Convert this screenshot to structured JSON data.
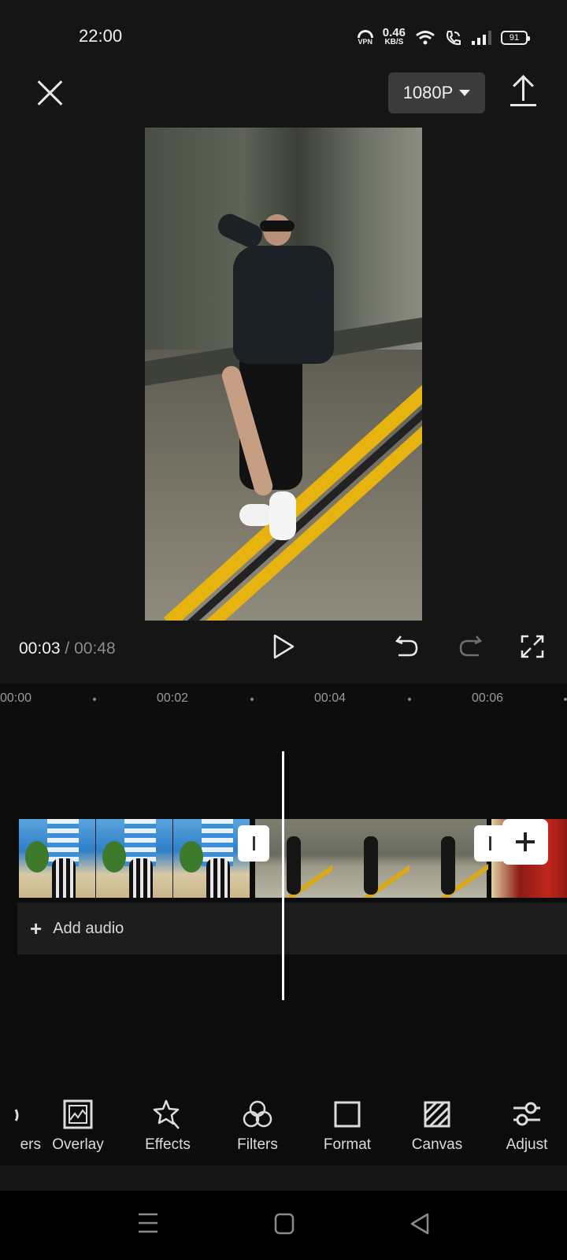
{
  "status_bar": {
    "time": "22:00",
    "vpn_label": "VPN",
    "net_speed_value": "0.46",
    "net_speed_unit": "KB/S",
    "battery_level": "91",
    "icons": [
      "vpn-icon",
      "wifi-icon",
      "wifi-calling-icon",
      "signal-icon",
      "battery-icon"
    ]
  },
  "top_bar": {
    "close_icon": "close-icon",
    "resolution": "1080P",
    "export_icon": "upload-icon"
  },
  "preview": {
    "description": "Woman in black bomber jacket and sunglasses posing on yellow road line in a tunnel"
  },
  "playback": {
    "current_time": "00:03",
    "separator": "/",
    "total_time": "00:48",
    "icons": [
      "play-icon",
      "undo-icon",
      "redo-icon",
      "fullscreen-icon"
    ]
  },
  "timeline": {
    "ruler": [
      "00:00",
      "00:02",
      "00:04",
      "00:06"
    ],
    "clips": [
      {
        "name": "clip-1",
        "description": "Woman in front of blue building"
      },
      {
        "name": "clip-2",
        "description": "Woman posing in tunnel"
      },
      {
        "name": "clip-3",
        "description": "Red decorated scene"
      }
    ],
    "add_audio_label": "Add audio"
  },
  "toolbar": {
    "items": [
      {
        "label": "Stickers",
        "visible_label": "ers",
        "icon": "sticker-icon"
      },
      {
        "label": "Overlay",
        "icon": "overlay-icon"
      },
      {
        "label": "Effects",
        "icon": "effects-icon"
      },
      {
        "label": "Filters",
        "icon": "filters-icon"
      },
      {
        "label": "Format",
        "icon": "format-icon"
      },
      {
        "label": "Canvas",
        "icon": "canvas-icon"
      },
      {
        "label": "Adjust",
        "icon": "adjust-icon"
      }
    ]
  },
  "nav_bar": {
    "icons": [
      "menu-icon",
      "home-icon",
      "back-icon"
    ]
  },
  "colors": {
    "background": "#151515",
    "timeline_background": "#0d0c0d",
    "resolution_button": "#3b3b3b",
    "audio_track": "#1e1d1e",
    "playhead": "#ffffff"
  }
}
